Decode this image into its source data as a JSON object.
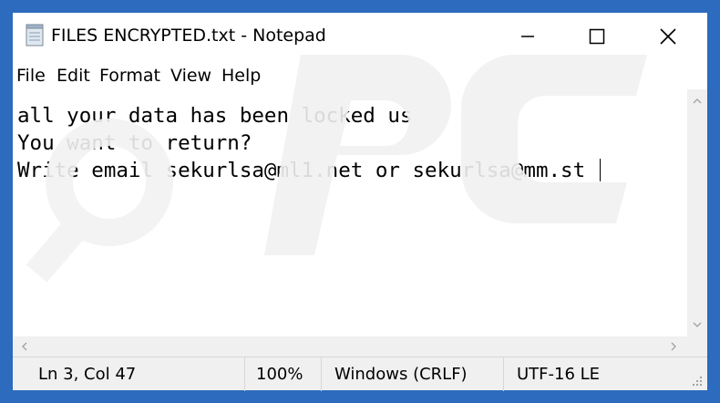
{
  "window": {
    "title": "FILES ENCRYPTED.txt - Notepad"
  },
  "menu": [
    "File",
    "Edit",
    "Format",
    "View",
    "Help"
  ],
  "editor": {
    "lines": [
      "all your data has been locked us",
      "You want to return?",
      "Write email sekurlsa@ml1.net or sekurlsa@mm.st"
    ]
  },
  "status": {
    "position": "Ln 3, Col 47",
    "zoom": "100%",
    "line_endings": "Windows (CRLF)",
    "encoding": "UTF-16 LE"
  },
  "icons": {
    "app": "notepad-icon",
    "minimize": "minimize-icon",
    "maximize": "maximize-icon",
    "close": "close-icon",
    "scroll_up": "chevron-up-icon",
    "scroll_down": "chevron-down-icon",
    "scroll_left": "chevron-left-icon",
    "scroll_right": "chevron-right-icon",
    "resize": "resize-grip-icon"
  },
  "colors": {
    "desktop_background": "#2c6bbd",
    "window_background": "#ffffff",
    "status_background": "#f0f0f0"
  }
}
